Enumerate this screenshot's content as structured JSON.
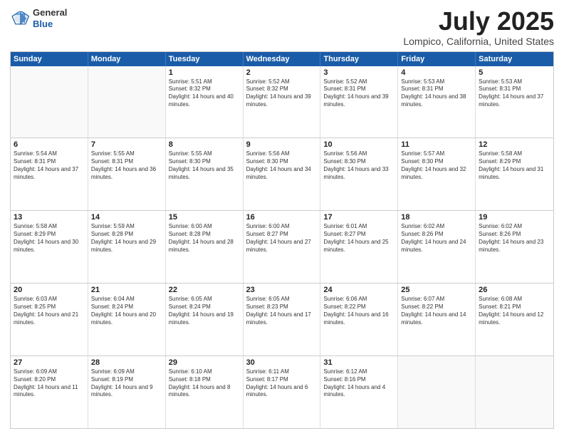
{
  "logo": {
    "general": "General",
    "blue": "Blue"
  },
  "title": "July 2025",
  "subtitle": "Lompico, California, United States",
  "weekdays": [
    "Sunday",
    "Monday",
    "Tuesday",
    "Wednesday",
    "Thursday",
    "Friday",
    "Saturday"
  ],
  "rows": [
    [
      {
        "day": "",
        "info": ""
      },
      {
        "day": "",
        "info": ""
      },
      {
        "day": "1",
        "info": "Sunrise: 5:51 AM\nSunset: 8:32 PM\nDaylight: 14 hours and 40 minutes."
      },
      {
        "day": "2",
        "info": "Sunrise: 5:52 AM\nSunset: 8:32 PM\nDaylight: 14 hours and 39 minutes."
      },
      {
        "day": "3",
        "info": "Sunrise: 5:52 AM\nSunset: 8:31 PM\nDaylight: 14 hours and 39 minutes."
      },
      {
        "day": "4",
        "info": "Sunrise: 5:53 AM\nSunset: 8:31 PM\nDaylight: 14 hours and 38 minutes."
      },
      {
        "day": "5",
        "info": "Sunrise: 5:53 AM\nSunset: 8:31 PM\nDaylight: 14 hours and 37 minutes."
      }
    ],
    [
      {
        "day": "6",
        "info": "Sunrise: 5:54 AM\nSunset: 8:31 PM\nDaylight: 14 hours and 37 minutes."
      },
      {
        "day": "7",
        "info": "Sunrise: 5:55 AM\nSunset: 8:31 PM\nDaylight: 14 hours and 36 minutes."
      },
      {
        "day": "8",
        "info": "Sunrise: 5:55 AM\nSunset: 8:30 PM\nDaylight: 14 hours and 35 minutes."
      },
      {
        "day": "9",
        "info": "Sunrise: 5:56 AM\nSunset: 8:30 PM\nDaylight: 14 hours and 34 minutes."
      },
      {
        "day": "10",
        "info": "Sunrise: 5:56 AM\nSunset: 8:30 PM\nDaylight: 14 hours and 33 minutes."
      },
      {
        "day": "11",
        "info": "Sunrise: 5:57 AM\nSunset: 8:30 PM\nDaylight: 14 hours and 32 minutes."
      },
      {
        "day": "12",
        "info": "Sunrise: 5:58 AM\nSunset: 8:29 PM\nDaylight: 14 hours and 31 minutes."
      }
    ],
    [
      {
        "day": "13",
        "info": "Sunrise: 5:58 AM\nSunset: 8:29 PM\nDaylight: 14 hours and 30 minutes."
      },
      {
        "day": "14",
        "info": "Sunrise: 5:59 AM\nSunset: 8:28 PM\nDaylight: 14 hours and 29 minutes."
      },
      {
        "day": "15",
        "info": "Sunrise: 6:00 AM\nSunset: 8:28 PM\nDaylight: 14 hours and 28 minutes."
      },
      {
        "day": "16",
        "info": "Sunrise: 6:00 AM\nSunset: 8:27 PM\nDaylight: 14 hours and 27 minutes."
      },
      {
        "day": "17",
        "info": "Sunrise: 6:01 AM\nSunset: 8:27 PM\nDaylight: 14 hours and 25 minutes."
      },
      {
        "day": "18",
        "info": "Sunrise: 6:02 AM\nSunset: 8:26 PM\nDaylight: 14 hours and 24 minutes."
      },
      {
        "day": "19",
        "info": "Sunrise: 6:02 AM\nSunset: 8:26 PM\nDaylight: 14 hours and 23 minutes."
      }
    ],
    [
      {
        "day": "20",
        "info": "Sunrise: 6:03 AM\nSunset: 8:25 PM\nDaylight: 14 hours and 21 minutes."
      },
      {
        "day": "21",
        "info": "Sunrise: 6:04 AM\nSunset: 8:24 PM\nDaylight: 14 hours and 20 minutes."
      },
      {
        "day": "22",
        "info": "Sunrise: 6:05 AM\nSunset: 8:24 PM\nDaylight: 14 hours and 19 minutes."
      },
      {
        "day": "23",
        "info": "Sunrise: 6:05 AM\nSunset: 8:23 PM\nDaylight: 14 hours and 17 minutes."
      },
      {
        "day": "24",
        "info": "Sunrise: 6:06 AM\nSunset: 8:22 PM\nDaylight: 14 hours and 16 minutes."
      },
      {
        "day": "25",
        "info": "Sunrise: 6:07 AM\nSunset: 8:22 PM\nDaylight: 14 hours and 14 minutes."
      },
      {
        "day": "26",
        "info": "Sunrise: 6:08 AM\nSunset: 8:21 PM\nDaylight: 14 hours and 12 minutes."
      }
    ],
    [
      {
        "day": "27",
        "info": "Sunrise: 6:09 AM\nSunset: 8:20 PM\nDaylight: 14 hours and 11 minutes."
      },
      {
        "day": "28",
        "info": "Sunrise: 6:09 AM\nSunset: 8:19 PM\nDaylight: 14 hours and 9 minutes."
      },
      {
        "day": "29",
        "info": "Sunrise: 6:10 AM\nSunset: 8:18 PM\nDaylight: 14 hours and 8 minutes."
      },
      {
        "day": "30",
        "info": "Sunrise: 6:11 AM\nSunset: 8:17 PM\nDaylight: 14 hours and 6 minutes."
      },
      {
        "day": "31",
        "info": "Sunrise: 6:12 AM\nSunset: 8:16 PM\nDaylight: 14 hours and 4 minutes."
      },
      {
        "day": "",
        "info": ""
      },
      {
        "day": "",
        "info": ""
      }
    ]
  ]
}
